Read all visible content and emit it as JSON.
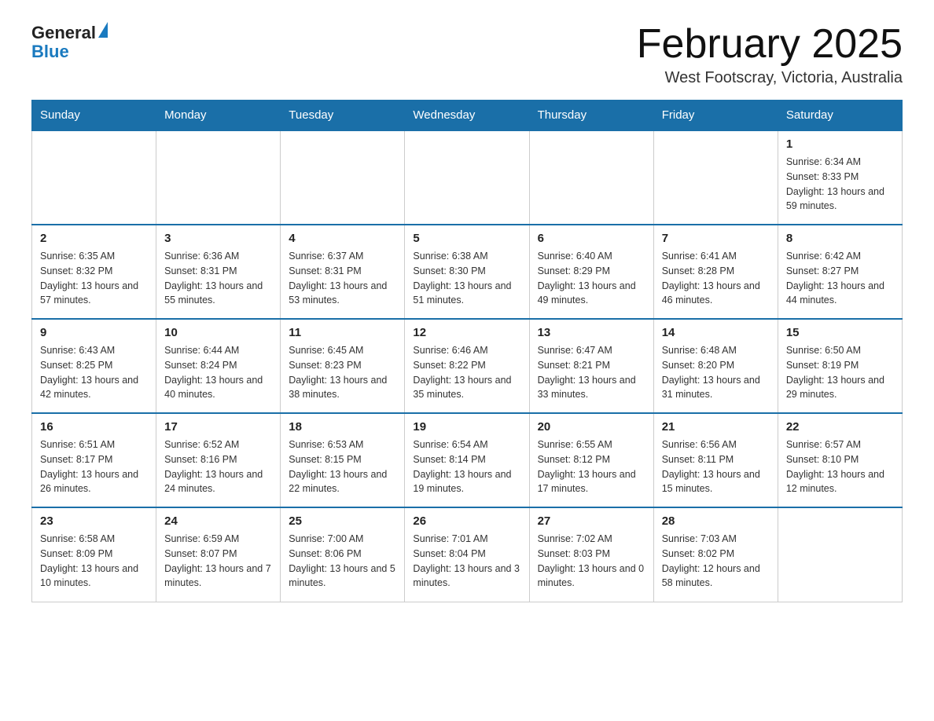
{
  "header": {
    "title": "February 2025",
    "subtitle": "West Footscray, Victoria, Australia",
    "logo_general": "General",
    "logo_blue": "Blue"
  },
  "days_of_week": [
    "Sunday",
    "Monday",
    "Tuesday",
    "Wednesday",
    "Thursday",
    "Friday",
    "Saturday"
  ],
  "weeks": [
    [
      {
        "day": "",
        "info": ""
      },
      {
        "day": "",
        "info": ""
      },
      {
        "day": "",
        "info": ""
      },
      {
        "day": "",
        "info": ""
      },
      {
        "day": "",
        "info": ""
      },
      {
        "day": "",
        "info": ""
      },
      {
        "day": "1",
        "info": "Sunrise: 6:34 AM\nSunset: 8:33 PM\nDaylight: 13 hours and 59 minutes."
      }
    ],
    [
      {
        "day": "2",
        "info": "Sunrise: 6:35 AM\nSunset: 8:32 PM\nDaylight: 13 hours and 57 minutes."
      },
      {
        "day": "3",
        "info": "Sunrise: 6:36 AM\nSunset: 8:31 PM\nDaylight: 13 hours and 55 minutes."
      },
      {
        "day": "4",
        "info": "Sunrise: 6:37 AM\nSunset: 8:31 PM\nDaylight: 13 hours and 53 minutes."
      },
      {
        "day": "5",
        "info": "Sunrise: 6:38 AM\nSunset: 8:30 PM\nDaylight: 13 hours and 51 minutes."
      },
      {
        "day": "6",
        "info": "Sunrise: 6:40 AM\nSunset: 8:29 PM\nDaylight: 13 hours and 49 minutes."
      },
      {
        "day": "7",
        "info": "Sunrise: 6:41 AM\nSunset: 8:28 PM\nDaylight: 13 hours and 46 minutes."
      },
      {
        "day": "8",
        "info": "Sunrise: 6:42 AM\nSunset: 8:27 PM\nDaylight: 13 hours and 44 minutes."
      }
    ],
    [
      {
        "day": "9",
        "info": "Sunrise: 6:43 AM\nSunset: 8:25 PM\nDaylight: 13 hours and 42 minutes."
      },
      {
        "day": "10",
        "info": "Sunrise: 6:44 AM\nSunset: 8:24 PM\nDaylight: 13 hours and 40 minutes."
      },
      {
        "day": "11",
        "info": "Sunrise: 6:45 AM\nSunset: 8:23 PM\nDaylight: 13 hours and 38 minutes."
      },
      {
        "day": "12",
        "info": "Sunrise: 6:46 AM\nSunset: 8:22 PM\nDaylight: 13 hours and 35 minutes."
      },
      {
        "day": "13",
        "info": "Sunrise: 6:47 AM\nSunset: 8:21 PM\nDaylight: 13 hours and 33 minutes."
      },
      {
        "day": "14",
        "info": "Sunrise: 6:48 AM\nSunset: 8:20 PM\nDaylight: 13 hours and 31 minutes."
      },
      {
        "day": "15",
        "info": "Sunrise: 6:50 AM\nSunset: 8:19 PM\nDaylight: 13 hours and 29 minutes."
      }
    ],
    [
      {
        "day": "16",
        "info": "Sunrise: 6:51 AM\nSunset: 8:17 PM\nDaylight: 13 hours and 26 minutes."
      },
      {
        "day": "17",
        "info": "Sunrise: 6:52 AM\nSunset: 8:16 PM\nDaylight: 13 hours and 24 minutes."
      },
      {
        "day": "18",
        "info": "Sunrise: 6:53 AM\nSunset: 8:15 PM\nDaylight: 13 hours and 22 minutes."
      },
      {
        "day": "19",
        "info": "Sunrise: 6:54 AM\nSunset: 8:14 PM\nDaylight: 13 hours and 19 minutes."
      },
      {
        "day": "20",
        "info": "Sunrise: 6:55 AM\nSunset: 8:12 PM\nDaylight: 13 hours and 17 minutes."
      },
      {
        "day": "21",
        "info": "Sunrise: 6:56 AM\nSunset: 8:11 PM\nDaylight: 13 hours and 15 minutes."
      },
      {
        "day": "22",
        "info": "Sunrise: 6:57 AM\nSunset: 8:10 PM\nDaylight: 13 hours and 12 minutes."
      }
    ],
    [
      {
        "day": "23",
        "info": "Sunrise: 6:58 AM\nSunset: 8:09 PM\nDaylight: 13 hours and 10 minutes."
      },
      {
        "day": "24",
        "info": "Sunrise: 6:59 AM\nSunset: 8:07 PM\nDaylight: 13 hours and 7 minutes."
      },
      {
        "day": "25",
        "info": "Sunrise: 7:00 AM\nSunset: 8:06 PM\nDaylight: 13 hours and 5 minutes."
      },
      {
        "day": "26",
        "info": "Sunrise: 7:01 AM\nSunset: 8:04 PM\nDaylight: 13 hours and 3 minutes."
      },
      {
        "day": "27",
        "info": "Sunrise: 7:02 AM\nSunset: 8:03 PM\nDaylight: 13 hours and 0 minutes."
      },
      {
        "day": "28",
        "info": "Sunrise: 7:03 AM\nSunset: 8:02 PM\nDaylight: 12 hours and 58 minutes."
      },
      {
        "day": "",
        "info": ""
      }
    ]
  ]
}
